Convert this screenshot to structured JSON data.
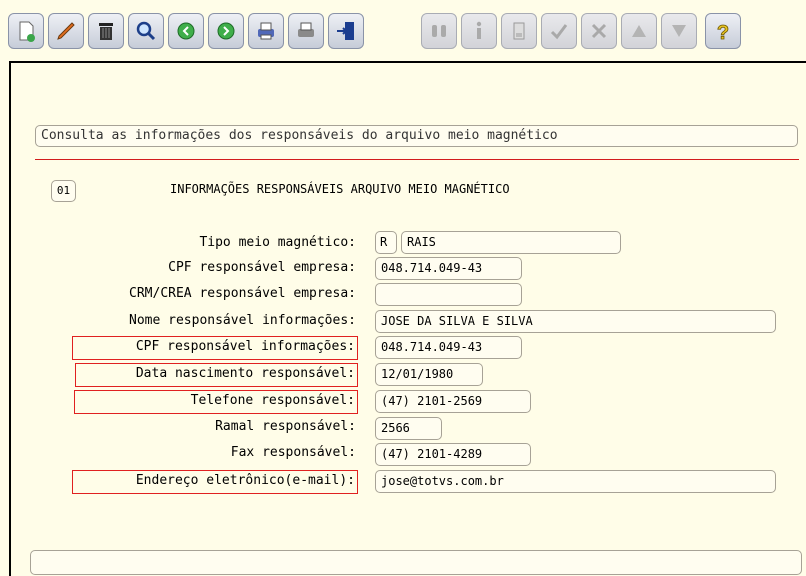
{
  "toolbar": {
    "buttons": [
      {
        "name": "new-button",
        "icon": "new-document-icon",
        "enabled": true
      },
      {
        "name": "edit-button",
        "icon": "pencil-icon",
        "enabled": true
      },
      {
        "name": "delete-button",
        "icon": "trash-icon",
        "enabled": true
      },
      {
        "name": "search-button",
        "icon": "magnifier-icon",
        "enabled": true
      },
      {
        "name": "previous-button",
        "icon": "arrow-left-icon",
        "enabled": true
      },
      {
        "name": "next-button",
        "icon": "arrow-right-icon",
        "enabled": true
      },
      {
        "name": "print-button",
        "icon": "printer-icon",
        "enabled": true
      },
      {
        "name": "list-button",
        "icon": "list-print-icon",
        "enabled": true
      },
      {
        "name": "exit-button",
        "icon": "exit-door-icon",
        "enabled": true
      },
      {
        "name": "binoculars-button",
        "icon": "binoculars-icon",
        "enabled": false
      },
      {
        "name": "info-button",
        "icon": "info-icon",
        "enabled": false
      },
      {
        "name": "calculator-button",
        "icon": "calculator-icon",
        "enabled": false
      },
      {
        "name": "confirm-button",
        "icon": "checkmark-icon",
        "enabled": false
      },
      {
        "name": "cancel-button",
        "icon": "cancel-tools-icon",
        "enabled": false
      },
      {
        "name": "first-button",
        "icon": "triangle-up-icon",
        "enabled": false
      },
      {
        "name": "last-button",
        "icon": "triangle-down-icon",
        "enabled": false
      },
      {
        "name": "help-button",
        "icon": "question-mark-icon",
        "enabled": true
      }
    ]
  },
  "form": {
    "description": "Consulta as informações dos responsáveis do arquivo meio magnético",
    "sequence": "01",
    "title": "INFORMAÇÕES RESPONSÁVEIS ARQUIVO MEIO MAGNÉTICO",
    "fields": {
      "tipo": {
        "label": "Tipo meio magnético:",
        "code": "R",
        "value": "RAIS"
      },
      "cpf_empresa": {
        "label": "CPF responsável empresa:",
        "value": "048.714.049-43"
      },
      "crm_crea": {
        "label": "CRM/CREA responsável empresa:",
        "value": ""
      },
      "nome": {
        "label": "Nome responsável informações:",
        "value": "JOSE DA SILVA E SILVA"
      },
      "cpf_info": {
        "label": "CPF responsável informações:",
        "value": "048.714.049-43"
      },
      "data_nasc": {
        "label": "Data nascimento responsável:",
        "value": "12/01/1980"
      },
      "telefone": {
        "label": "Telefone responsável:",
        "value": "(47) 2101-2569"
      },
      "ramal": {
        "label": "Ramal responsável:",
        "value": "2566"
      },
      "fax": {
        "label": "Fax responsável:",
        "value": "(47) 2101-4289"
      },
      "email": {
        "label": "Endereço eletrônico(e-mail):",
        "value": "jose@totvs.com.br"
      }
    },
    "status_bar": ""
  },
  "colors": {
    "background": "#fffde8",
    "highlight": "#e02020",
    "separator": "#d21c1c"
  }
}
